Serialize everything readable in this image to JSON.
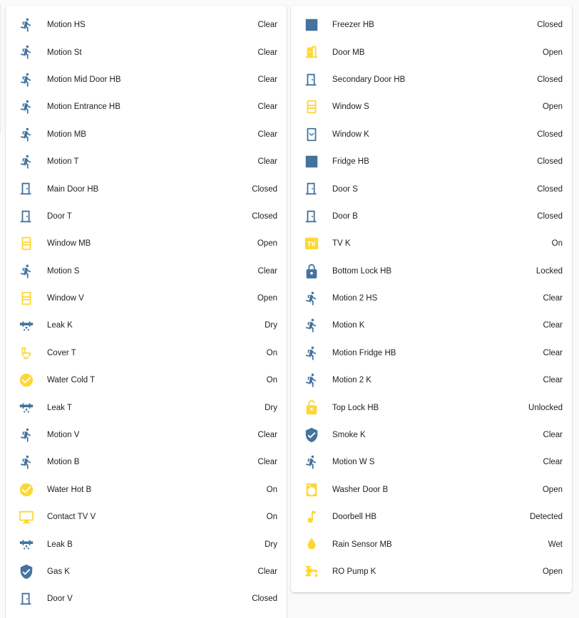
{
  "colors": {
    "icon_off": "#44739e",
    "icon_on": "#fdd835",
    "text": "#212121",
    "card": "#ffffff",
    "background": "#fafafa"
  },
  "left_entities": [
    {
      "icon": "walk-icon",
      "active": false,
      "name": "Motion HS",
      "state": "Clear"
    },
    {
      "icon": "walk-icon",
      "active": false,
      "name": "Motion St",
      "state": "Clear"
    },
    {
      "icon": "walk-icon",
      "active": false,
      "name": "Motion Mid Door HB",
      "state": "Clear"
    },
    {
      "icon": "walk-icon",
      "active": false,
      "name": "Motion Entrance HB",
      "state": "Clear"
    },
    {
      "icon": "walk-icon",
      "active": false,
      "name": "Motion MB",
      "state": "Clear"
    },
    {
      "icon": "walk-icon",
      "active": false,
      "name": "Motion T",
      "state": "Clear"
    },
    {
      "icon": "door-closed-icon",
      "active": false,
      "name": "Main Door HB",
      "state": "Closed"
    },
    {
      "icon": "door-closed-icon",
      "active": false,
      "name": "Door T",
      "state": "Closed"
    },
    {
      "icon": "window-open-icon",
      "active": true,
      "name": "Window MB",
      "state": "Open"
    },
    {
      "icon": "walk-icon",
      "active": false,
      "name": "Motion S",
      "state": "Clear"
    },
    {
      "icon": "window-open-icon",
      "active": true,
      "name": "Window V",
      "state": "Open"
    },
    {
      "icon": "pipe-leak-icon",
      "active": false,
      "name": "Leak K",
      "state": "Dry"
    },
    {
      "icon": "toilet-icon",
      "active": true,
      "name": "Cover T",
      "state": "On"
    },
    {
      "icon": "check-circle-icon",
      "active": true,
      "name": "Water Cold T",
      "state": "On"
    },
    {
      "icon": "pipe-leak-icon",
      "active": false,
      "name": "Leak T",
      "state": "Dry"
    },
    {
      "icon": "walk-icon",
      "active": false,
      "name": "Motion V",
      "state": "Clear"
    },
    {
      "icon": "walk-icon",
      "active": false,
      "name": "Motion B",
      "state": "Clear"
    },
    {
      "icon": "check-circle-icon",
      "active": true,
      "name": "Water Hot B",
      "state": "On"
    },
    {
      "icon": "monitor-icon",
      "active": true,
      "name": "Contact TV V",
      "state": "On"
    },
    {
      "icon": "pipe-leak-icon",
      "active": false,
      "name": "Leak B",
      "state": "Dry"
    },
    {
      "icon": "shield-check-icon",
      "active": false,
      "name": "Gas K",
      "state": "Clear"
    },
    {
      "icon": "door-closed-icon",
      "active": false,
      "name": "Door V",
      "state": "Closed"
    }
  ],
  "right_entities": [
    {
      "icon": "square-icon",
      "active": false,
      "name": "Freezer HB",
      "state": "Closed"
    },
    {
      "icon": "door-open-icon",
      "active": true,
      "name": "Door MB",
      "state": "Open"
    },
    {
      "icon": "door-closed-icon",
      "active": false,
      "name": "Secondary Door HB",
      "state": "Closed"
    },
    {
      "icon": "window-open-icon",
      "active": true,
      "name": "Window S",
      "state": "Open"
    },
    {
      "icon": "window-closed-icon",
      "active": false,
      "name": "Window K",
      "state": "Closed"
    },
    {
      "icon": "square-icon",
      "active": false,
      "name": "Fridge HB",
      "state": "Closed"
    },
    {
      "icon": "door-closed-icon",
      "active": false,
      "name": "Door S",
      "state": "Closed"
    },
    {
      "icon": "door-closed-icon",
      "active": false,
      "name": "Door B",
      "state": "Closed"
    },
    {
      "icon": "tv-box-icon",
      "active": true,
      "name": "TV K",
      "state": "On"
    },
    {
      "icon": "lock-icon",
      "active": false,
      "name": "Bottom Lock HB",
      "state": "Locked"
    },
    {
      "icon": "walk-icon",
      "active": false,
      "name": "Motion 2 HS",
      "state": "Clear"
    },
    {
      "icon": "walk-icon",
      "active": false,
      "name": "Motion K",
      "state": "Clear"
    },
    {
      "icon": "walk-icon",
      "active": false,
      "name": "Motion Fridge HB",
      "state": "Clear"
    },
    {
      "icon": "walk-icon",
      "active": false,
      "name": "Motion 2 K",
      "state": "Clear"
    },
    {
      "icon": "lock-open-icon",
      "active": true,
      "name": "Top Lock HB",
      "state": "Unlocked"
    },
    {
      "icon": "shield-check-icon",
      "active": false,
      "name": "Smoke K",
      "state": "Clear"
    },
    {
      "icon": "walk-icon",
      "active": false,
      "name": "Motion W S",
      "state": "Clear"
    },
    {
      "icon": "washing-machine-icon",
      "active": true,
      "name": "Washer Door B",
      "state": "Open"
    },
    {
      "icon": "music-note-icon",
      "active": true,
      "name": "Doorbell HB",
      "state": "Detected"
    },
    {
      "icon": "water-drop-icon",
      "active": true,
      "name": "Rain Sensor MB",
      "state": "Wet"
    },
    {
      "icon": "water-pump-icon",
      "active": true,
      "name": "RO Pump K",
      "state": "Open"
    }
  ]
}
